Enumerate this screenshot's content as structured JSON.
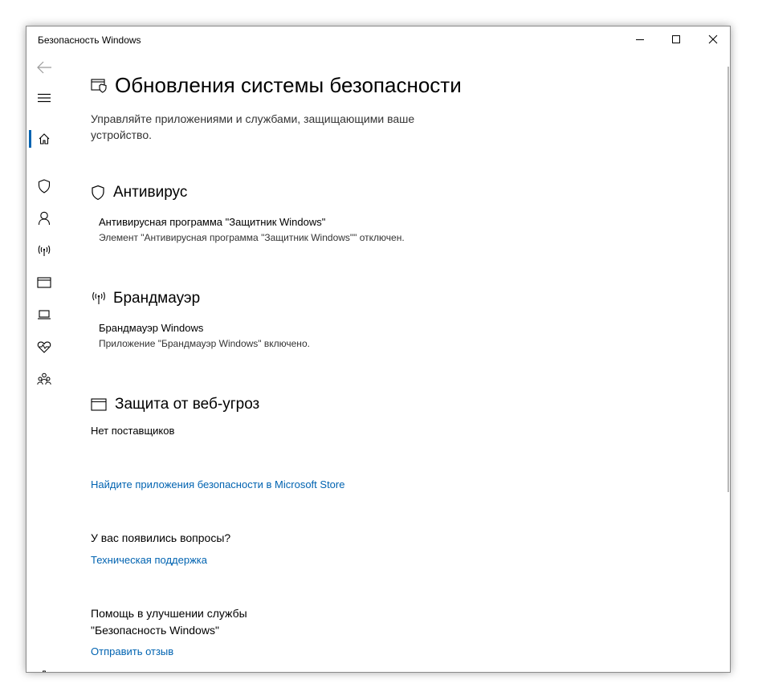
{
  "window": {
    "title": "Безопасность Windows"
  },
  "sidebar": {
    "items": [
      {
        "icon": "back-arrow-icon"
      },
      {
        "icon": "hamburger-menu-icon"
      },
      {
        "icon": "home-icon",
        "active": true
      },
      {
        "icon": "shield-icon"
      },
      {
        "icon": "person-icon"
      },
      {
        "icon": "wifi-antenna-icon"
      },
      {
        "icon": "browser-window-icon"
      },
      {
        "icon": "laptop-icon"
      },
      {
        "icon": "heart-health-icon"
      },
      {
        "icon": "family-icon"
      },
      {
        "icon": "gear-icon"
      }
    ]
  },
  "page": {
    "title": "Обновления системы безопасности",
    "description": "Управляйте приложениями и службами, защищающими ваше устройство."
  },
  "sections": {
    "antivirus": {
      "title": "Антивирус",
      "provider_name": "Антивирусная программа \"Защитник Windows\"",
      "provider_status": "Элемент \"Антивирусная программа \"Защитник Windows\"\" отключен."
    },
    "firewall": {
      "title": "Брандмауэр",
      "provider_name": "Брандмауэр Windows",
      "provider_status": "Приложение \"Брандмауэр Windows\" включено."
    },
    "web_protection": {
      "title": "Защита от веб-угроз",
      "empty_text": "Нет поставщиков"
    }
  },
  "links": {
    "store": "Найдите приложения безопасности в Microsoft Store",
    "support_question": "У вас появились вопросы?",
    "support_link": "Техническая поддержка",
    "improve_text": "Помощь в улучшении службы \"Безопасность Windows\"",
    "feedback_link": "Отправить отзыв"
  },
  "colors": {
    "accent": "#0063b1",
    "link": "#0063b1"
  }
}
